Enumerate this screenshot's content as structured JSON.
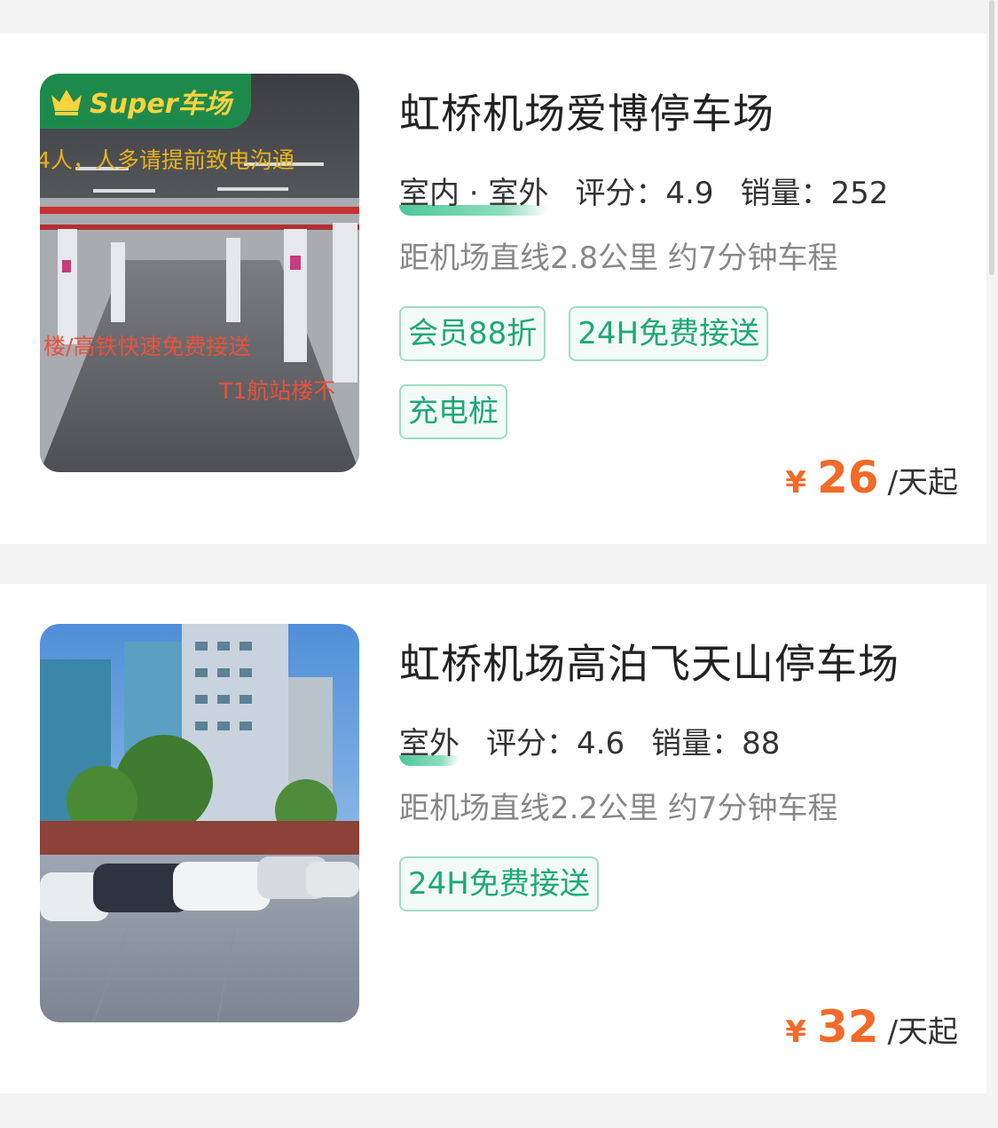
{
  "listings": [
    {
      "badge": "Super车场",
      "photo_overlay": [
        "4人，人多请提前致电沟通",
        "楼/高铁快速免费接送",
        "T1航站楼不"
      ],
      "name": "虹桥机场爱博停车场",
      "env": "室内 · 室外",
      "rating_label": "评分：4.9",
      "sales_label": "销量：252",
      "distance": "距机场直线2.8公里 约7分钟车程",
      "tags": [
        "会员88折",
        "24H免费接送",
        "充电桩"
      ],
      "currency": "¥",
      "price": "26",
      "price_unit": "/天起"
    },
    {
      "name": "虹桥机场高泊飞天山停车场",
      "env": "室外",
      "rating_label": "评分：4.6",
      "sales_label": "销量：88",
      "distance": "距机场直线2.2公里 约7分钟车程",
      "tags": [
        "24H免费接送"
      ],
      "currency": "¥",
      "price": "32",
      "price_unit": "/天起"
    }
  ],
  "colors": {
    "accent_green": "#1ea876",
    "tag_border": "#9fdcc5",
    "price_orange": "#f26a28",
    "badge_green": "#1d8a4c"
  }
}
